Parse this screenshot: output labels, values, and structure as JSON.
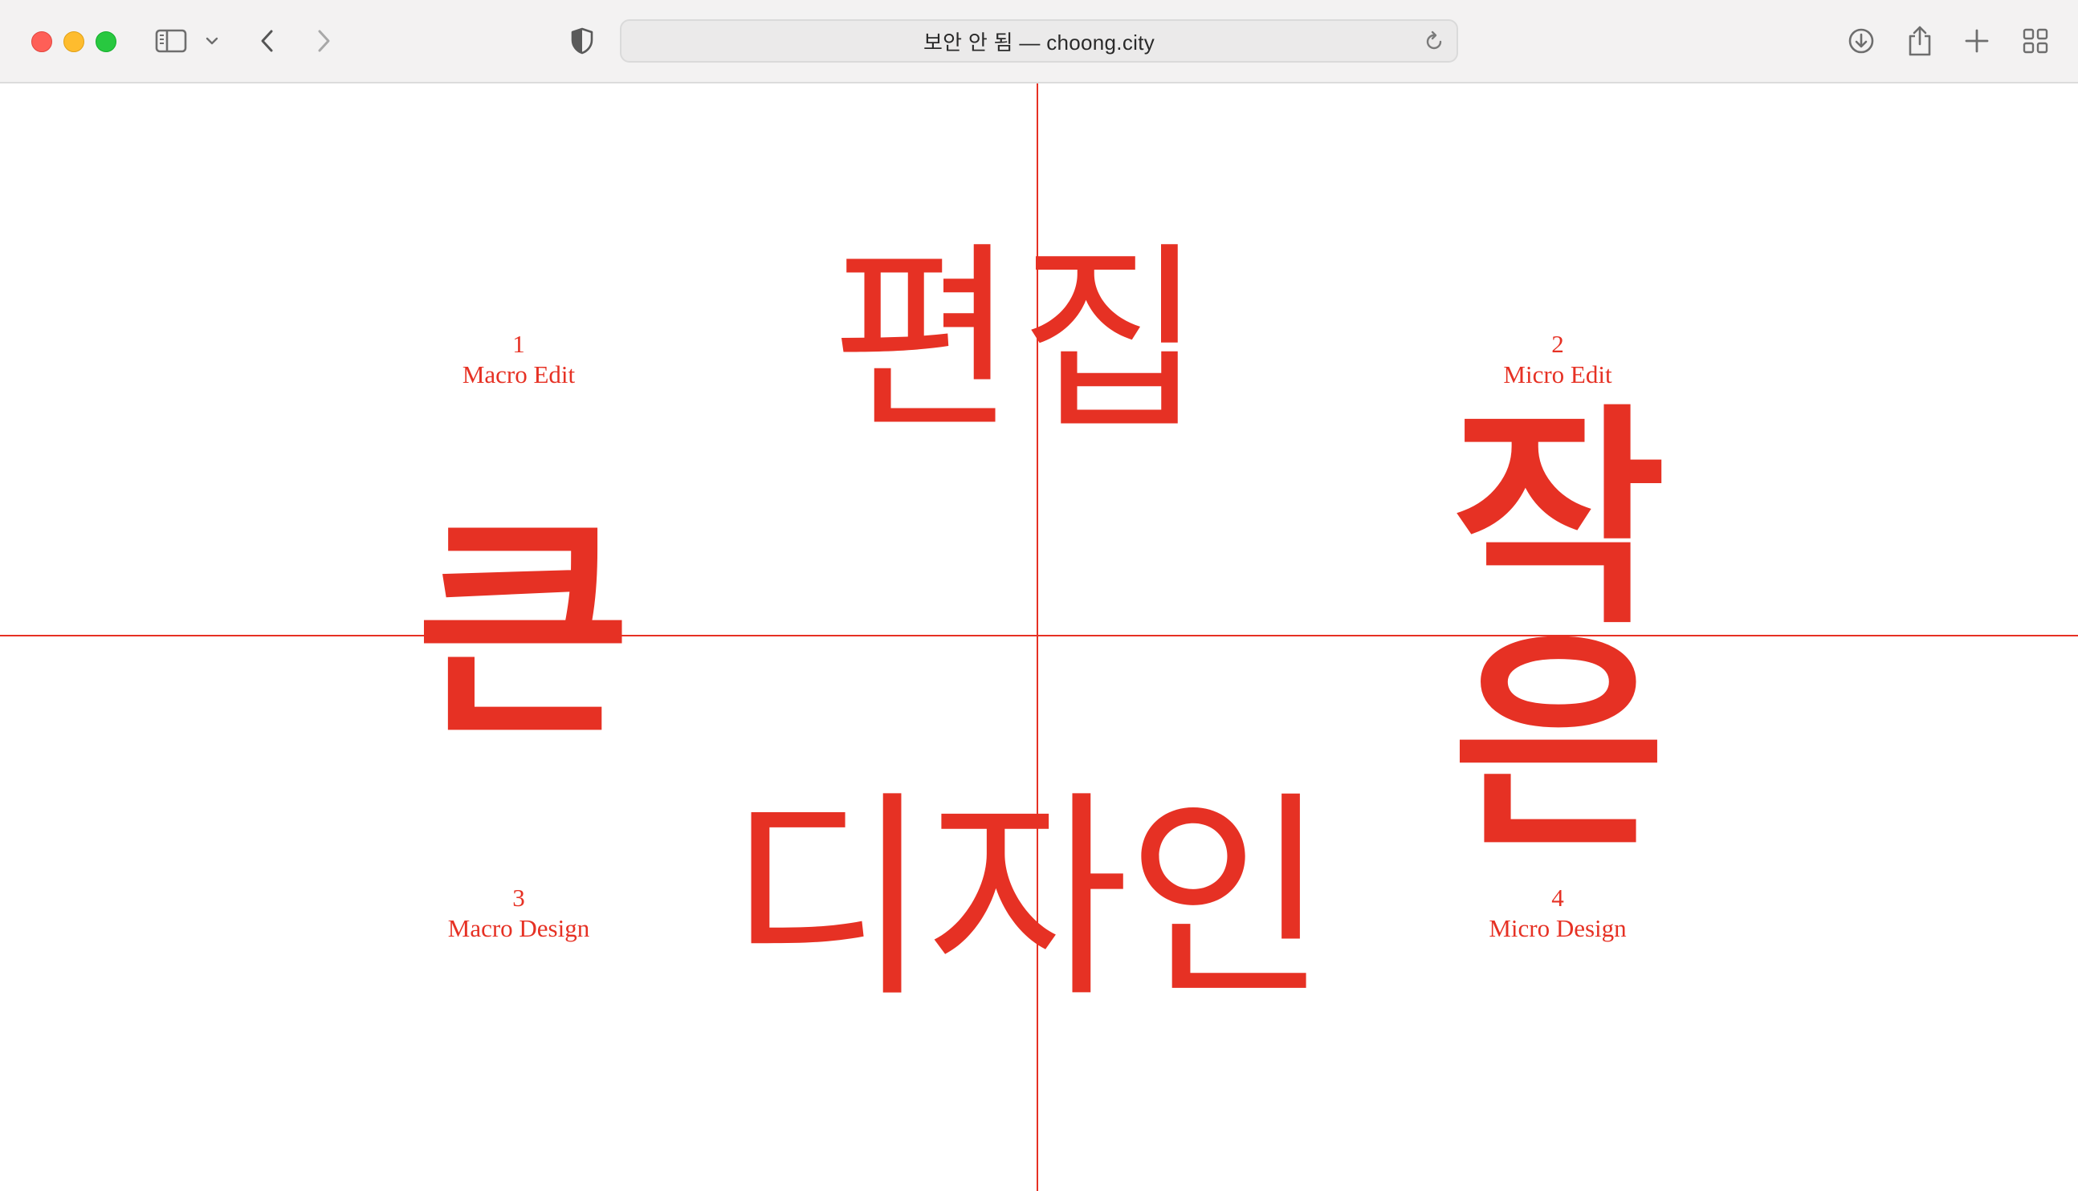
{
  "browser": {
    "address_text": "보안 안 됨 — choong.city",
    "icons": {
      "sidebar": "sidebar-icon",
      "sidebar_menu": "chevron-down-icon",
      "back": "chevron-left-icon",
      "forward": "chevron-right-icon",
      "privacy": "shield-icon",
      "reload": "reload-icon",
      "download": "download-icon",
      "share": "share-icon",
      "new_tab": "plus-icon",
      "tab_overview": "grid-icon"
    }
  },
  "page": {
    "accent_color": "#e63124",
    "quadrants": [
      {
        "number": "1",
        "name": "Macro Edit"
      },
      {
        "number": "2",
        "name": "Micro Edit"
      },
      {
        "number": "3",
        "name": "Macro Design"
      },
      {
        "number": "4",
        "name": "Micro Design"
      }
    ],
    "words": {
      "edit": "편집",
      "design": "디자인",
      "big": "큰",
      "small_top": "작",
      "small_bottom": "은"
    }
  }
}
